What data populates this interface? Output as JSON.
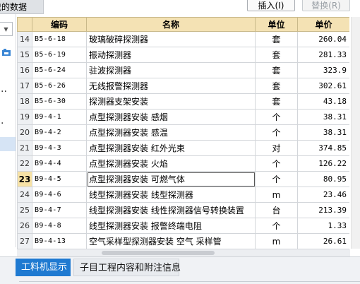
{
  "top": {
    "tab_label": "我的数据",
    "insert_button": "插入(I)",
    "replace_button": "替换(R)"
  },
  "grid": {
    "headers": [
      "编码",
      "名称",
      "单位",
      "单价"
    ],
    "rows": [
      {
        "index": "14",
        "code": "B5-6-18",
        "name": "玻璃破碎探测器",
        "unit": "套",
        "price": "260.04"
      },
      {
        "index": "15",
        "code": "B5-6-19",
        "name": "振动探测器",
        "unit": "套",
        "price": "281.33"
      },
      {
        "index": "16",
        "code": "B5-6-24",
        "name": "驻波探测器",
        "unit": "套",
        "price": "323.9"
      },
      {
        "index": "17",
        "code": "B5-6-26",
        "name": "无线报警探测器",
        "unit": "套",
        "price": "302.61"
      },
      {
        "index": "18",
        "code": "B5-6-30",
        "name": "探测器支架安装",
        "unit": "套",
        "price": "43.18"
      },
      {
        "index": "19",
        "code": "B9-4-1",
        "name": "点型探测器安装 感烟",
        "unit": "个",
        "price": "38.31"
      },
      {
        "index": "20",
        "code": "B9-4-2",
        "name": "点型探测器安装 感温",
        "unit": "个",
        "price": "38.31"
      },
      {
        "index": "21",
        "code": "B9-4-3",
        "name": "点型探测器安装 红外光束",
        "unit": "对",
        "price": "374.85"
      },
      {
        "index": "22",
        "code": "B9-4-4",
        "name": "点型探测器安装 火焰",
        "unit": "个",
        "price": "126.22"
      },
      {
        "index": "23",
        "code": "B9-4-5",
        "name": "点型探测器安装 可燃气体",
        "unit": "个",
        "price": "80.95"
      },
      {
        "index": "24",
        "code": "B9-4-6",
        "name": "线型探测器安装 线型探测器",
        "unit": "m",
        "price": "23.46"
      },
      {
        "index": "25",
        "code": "B9-4-7",
        "name": "线型探测器安装 线性探测器信号转换装置",
        "unit": "台",
        "price": "213.39"
      },
      {
        "index": "26",
        "code": "B9-4-8",
        "name": "线型探测器安装 报警终端电阻",
        "unit": "个",
        "price": "1.33"
      },
      {
        "index": "27",
        "code": "B9-4-13",
        "name": "空气采样型探测器安装 空气 采样管",
        "unit": "m",
        "price": "26.61"
      }
    ],
    "current_row_index": "23"
  },
  "bottom": {
    "tab_active": "工料机显示",
    "tab_other": "子目工程内容和附注信息"
  },
  "colors": {
    "header_bg": "#f4e2b4",
    "active_tab_bg": "#1f7ad1",
    "current_row_marker": "#f7e2a6"
  }
}
